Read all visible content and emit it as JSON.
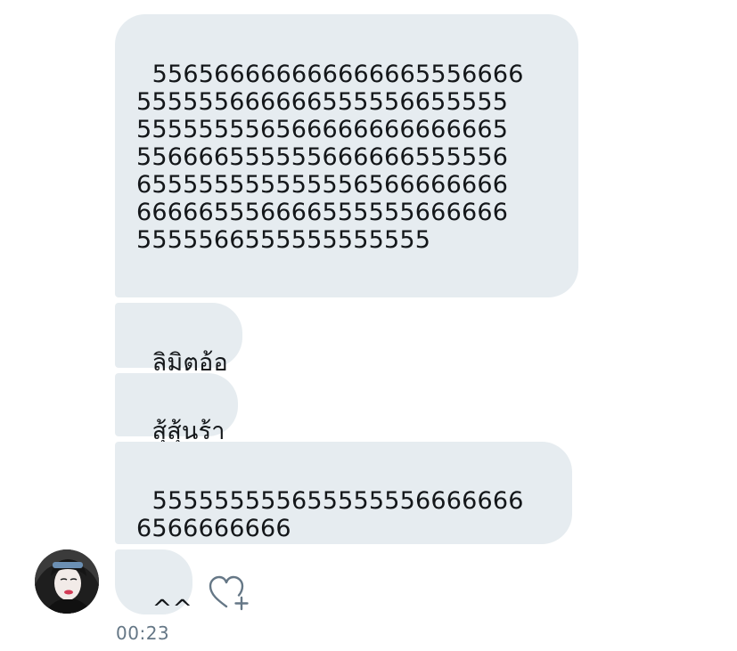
{
  "messages": [
    {
      "id": "m1",
      "text": "556566666666666665556666\n555555666666555556655555\n555555556566666666666665\n556666555555666666555556\n655555555555556566666666\n666665556666555555666666\n5555566555555555555"
    },
    {
      "id": "m2",
      "text": "ลิมิตอ้อ"
    },
    {
      "id": "m3",
      "text": "สุ้สุ้นร้า"
    },
    {
      "id": "m4",
      "text": "555555555655555556666666\n6566666666"
    },
    {
      "id": "m5",
      "text": "^^"
    }
  ],
  "timestamp": "00:23",
  "icons": {
    "avatar": "user-avatar",
    "like": "heart-plus-icon"
  },
  "colors": {
    "bubble": "#e6ecf0",
    "text": "#14171a",
    "meta": "#657786",
    "icon": "#657786"
  }
}
